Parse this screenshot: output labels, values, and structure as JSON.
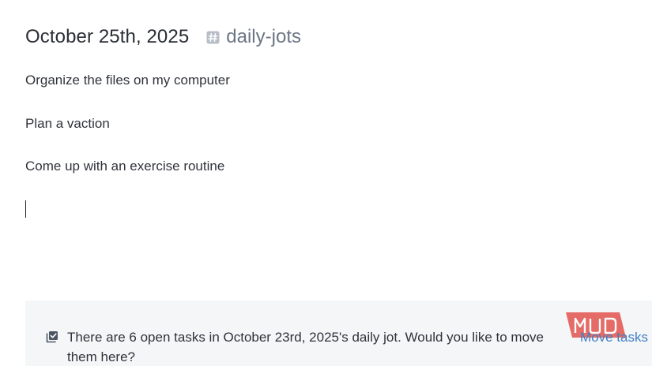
{
  "page": {
    "title": "October 25th, 2025",
    "tag": {
      "label": "daily-jots",
      "icon": "hashtag-icon"
    }
  },
  "editor": {
    "lines": [
      "Organize the files on my computer",
      "Plan a vaction",
      "Come up with an exercise routine"
    ]
  },
  "notice": {
    "icon": "tasks-checkbox-icon",
    "text": "There are 6 open tasks in October 23rd, 2025's daily jot. Would you like to move them here?",
    "action_label": "Move tasks"
  },
  "watermark": {
    "text": "MUO",
    "color": "#e2534d"
  }
}
